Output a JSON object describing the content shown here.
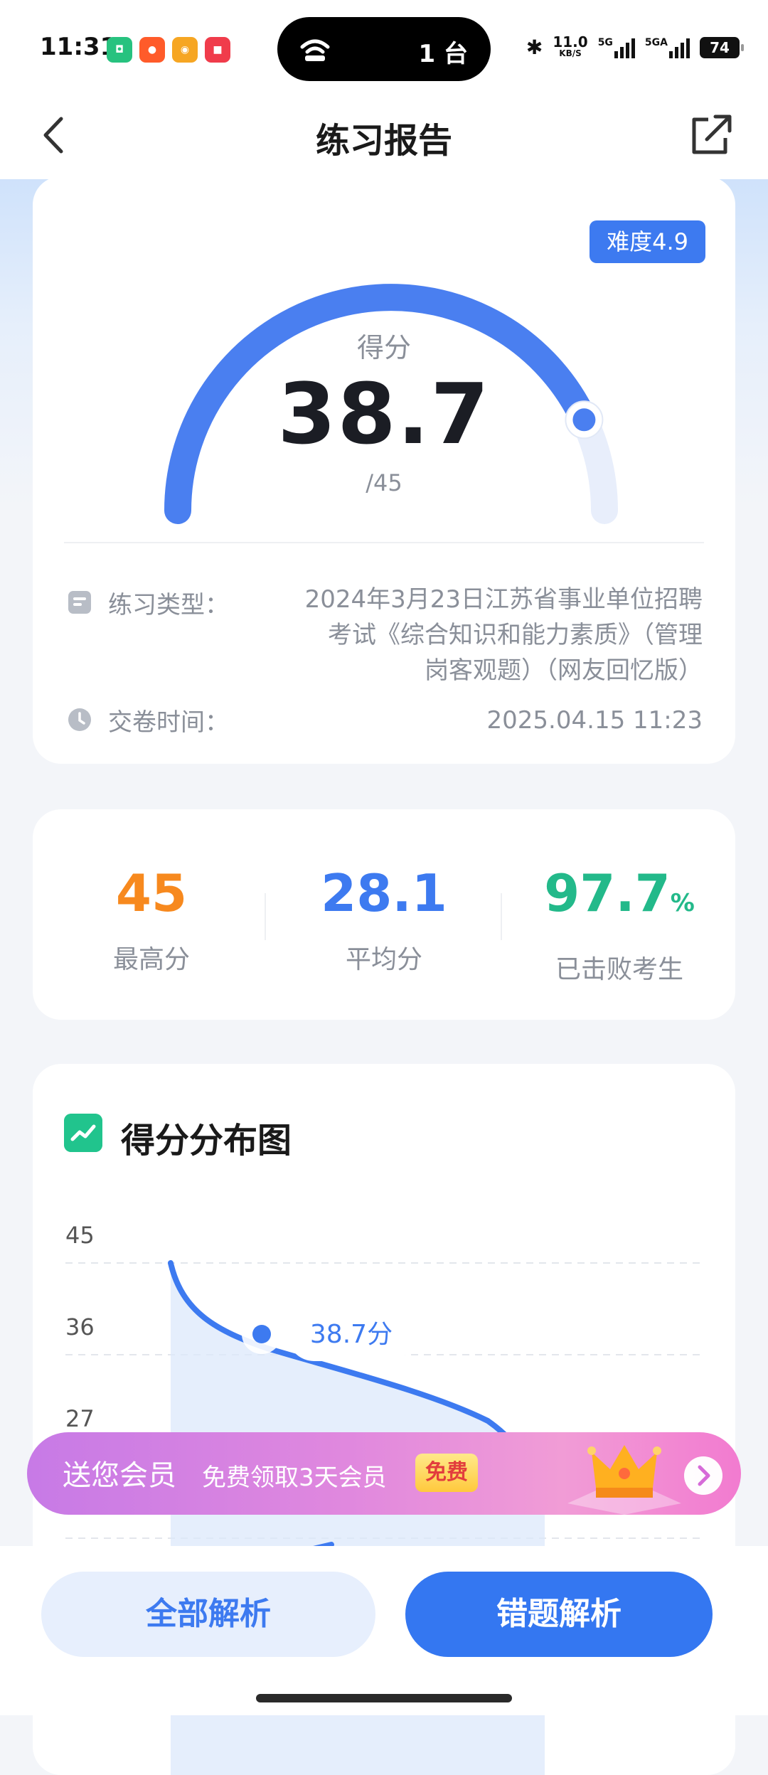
{
  "status_bar": {
    "time": "11:31",
    "island_count": "1 台",
    "net_speed_top": "11.0",
    "net_speed_unit": "KB/S",
    "signal1_label": "5G",
    "signal2_label": "5GA",
    "battery": "74"
  },
  "nav": {
    "title": "练习报告",
    "back_icon": "chevron-left-icon",
    "share_icon": "share-out-icon"
  },
  "score_card": {
    "difficulty": "难度4.9",
    "score_label": "得分",
    "score": "38.7",
    "total": "/45",
    "score_fraction": 0.86,
    "type_label": "练习类型：",
    "type_value": "2024年3月23日江苏省事业单位招聘考试《综合知识和能力素质》（管理岗客观题）（网友回忆版）",
    "time_label": "交卷时间：",
    "time_value": "2025.04.15 11:23"
  },
  "stats": {
    "max_value": "45",
    "max_label": "最高分",
    "avg_value": "28.1",
    "avg_label": "平均分",
    "beat_value": "97.7",
    "beat_unit": "%",
    "beat_label": "已击败考生"
  },
  "chart_data": {
    "type": "area",
    "title": "得分分布图",
    "y_ticks": [
      "45",
      "36",
      "27"
    ],
    "ylim": [
      18,
      45
    ],
    "marker_value": 38.7,
    "marker_label": "38.7分",
    "line_color": "#3d7af0",
    "fill_color": "#dce8fb"
  },
  "promo": {
    "main": "送您会员",
    "sub": "免费领取3天会员",
    "tag": "免费"
  },
  "buttons": {
    "all": "全部解析",
    "wrong": "错题解析"
  },
  "colors": {
    "accent": "#3d7af0",
    "orange": "#f7891e",
    "blue": "#3d7af0",
    "green": "#23b98a"
  }
}
